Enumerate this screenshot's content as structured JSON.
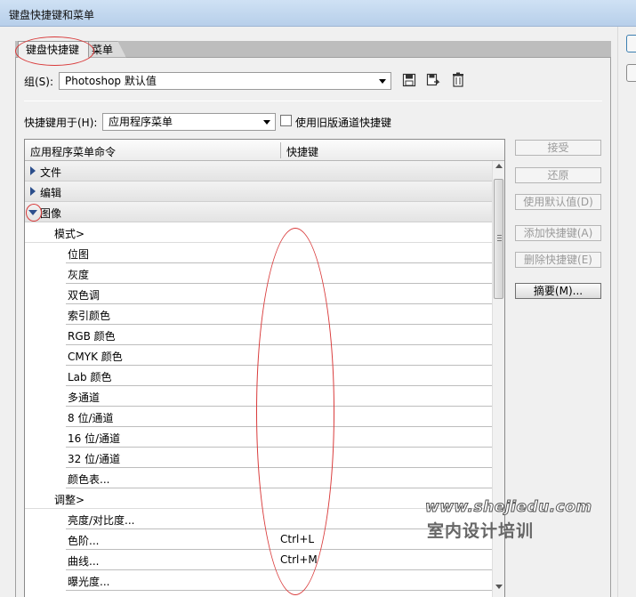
{
  "window": {
    "title": "键盘快捷键和菜单"
  },
  "tabs": [
    {
      "label": "键盘快捷键"
    },
    {
      "label": "菜单"
    }
  ],
  "group": {
    "label": "组(S):",
    "value": "Photoshop 默认值"
  },
  "shortcuts_for": {
    "label": "快捷键用于(H):",
    "value": "应用程序菜单"
  },
  "legacy_checkbox": {
    "label": "使用旧版通道快捷键",
    "checked": false
  },
  "table": {
    "headers": {
      "command": "应用程序菜单命令",
      "shortcut": "快捷键"
    },
    "rows": [
      {
        "cmd": "文件",
        "key": ""
      },
      {
        "cmd": "编辑",
        "key": ""
      },
      {
        "cmd": "图像",
        "key": ""
      },
      {
        "cmd": "模式>",
        "key": ""
      },
      {
        "cmd": "位图",
        "key": ""
      },
      {
        "cmd": "灰度",
        "key": ""
      },
      {
        "cmd": "双色调",
        "key": ""
      },
      {
        "cmd": "索引颜色",
        "key": ""
      },
      {
        "cmd": "RGB 颜色",
        "key": ""
      },
      {
        "cmd": "CMYK 颜色",
        "key": ""
      },
      {
        "cmd": "Lab 颜色",
        "key": ""
      },
      {
        "cmd": "多通道",
        "key": ""
      },
      {
        "cmd": "8 位/通道",
        "key": ""
      },
      {
        "cmd": "16 位/通道",
        "key": ""
      },
      {
        "cmd": "32 位/通道",
        "key": ""
      },
      {
        "cmd": "颜色表...",
        "key": ""
      },
      {
        "cmd": "调整>",
        "key": ""
      },
      {
        "cmd": "亮度/对比度...",
        "key": ""
      },
      {
        "cmd": "色阶...",
        "key": "Ctrl+L"
      },
      {
        "cmd": "曲线...",
        "key": "Ctrl+M"
      },
      {
        "cmd": "曝光度...",
        "key": ""
      }
    ]
  },
  "buttons": {
    "accept": "接受",
    "undo": "还原",
    "use_default": "使用默认值(D)",
    "add_shortcut": "添加快捷键(A)",
    "delete_shortcut": "删除快捷键(E)",
    "summarize": "摘要(M)..."
  },
  "watermark": {
    "line1": "www.shejiedu.com",
    "line2": "室内设计培训"
  },
  "colors": {
    "annotation": "#d93a3a",
    "expander": "#2b4e8c"
  },
  "icons": [
    "save-set-icon",
    "save-as-set-icon",
    "delete-set-icon"
  ]
}
